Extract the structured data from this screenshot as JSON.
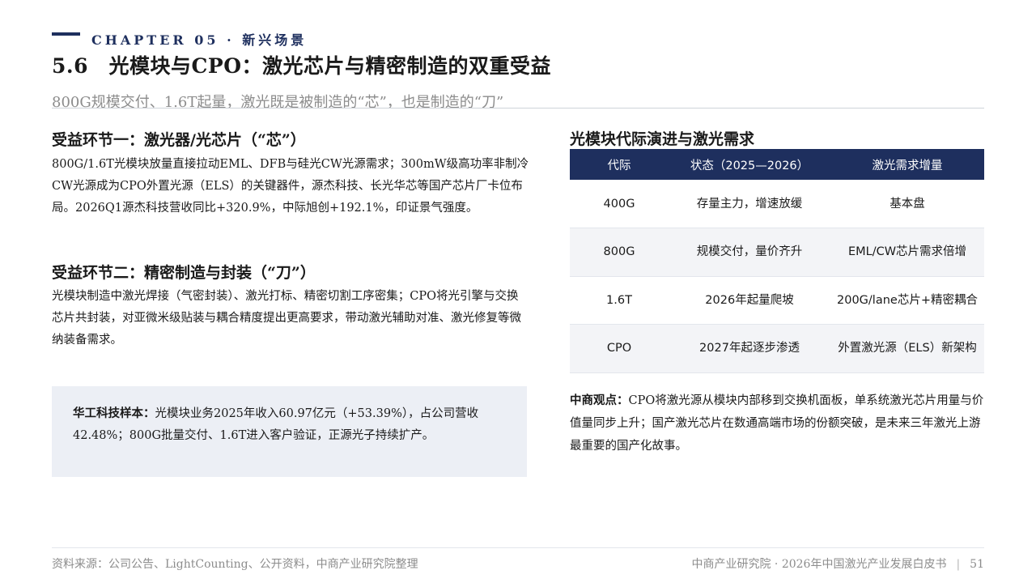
{
  "header": {
    "chapter": "CHAPTER 05 · 新兴场景",
    "title": "5.6　光模块与CPO：激光芯片与精密制造的双重受益",
    "subtitle": "800G规模交付、1.6T起量，激光既是被制造的“芯”，也是制造的“刀”"
  },
  "sections": [
    {
      "heading": "受益环节一：激光器/光芯片（“芯”）",
      "body": "800G/1.6T光模块放量直接拉动EML、DFB与硅光CW光源需求；300mW级高功率非制冷CW光源成为CPO外置光源（ELS）的关键器件，源杰科技、长光华芯等国产芯片厂卡位布局。2026Q1源杰科技营收同比+320.9%，中际旭创+192.1%，印证景气强度。"
    },
    {
      "heading": "受益环节二：精密制造与封装（“刀”）",
      "body": "光模块制造中激光焊接（气密封装）、激光打标、精密切割工序密集；CPO将光引擎与交换芯片共封装，对亚微米级贴装与耦合精度提出更高要求，带动激光辅助对准、激光修复等微纳装备需求。"
    }
  ],
  "sample": {
    "lead": "华工科技样本：",
    "text": "光模块业务2025年收入60.97亿元（+53.39%），占公司营收42.48%；800G批量交付、1.6T进入客户验证，正源光子持续扩产。"
  },
  "table": {
    "title": "光模块代际演进与激光需求",
    "headers": [
      "代际",
      "状态（2025—2026）",
      "激光需求增量"
    ],
    "rows": [
      [
        "400G",
        "存量主力，增速放缓",
        "基本盘"
      ],
      [
        "800G",
        "规模交付，量价齐升",
        "EML/CW芯片需求倍增"
      ],
      [
        "1.6T",
        "2026年起量爬坡",
        "200G/lane芯片+精密耦合"
      ],
      [
        "CPO",
        "2027年起逐步渗透",
        "外置激光源（ELS）新架构"
      ]
    ]
  },
  "viewpoint": {
    "lead": "中商观点：",
    "text": "CPO将激光源从模块内部移到交换机面板，单系统激光芯片用量与价值量同步上升；国产激光芯片在数通高端市场的份额突破，是未来三年激光上游最重要的国产化故事。"
  },
  "footer": {
    "source": "资料来源：公司公告、LightCounting、公开资料，中商产业研究院整理",
    "publication": "中商产业研究院 · 2026年中国激光产业发展白皮书",
    "page": "51"
  }
}
